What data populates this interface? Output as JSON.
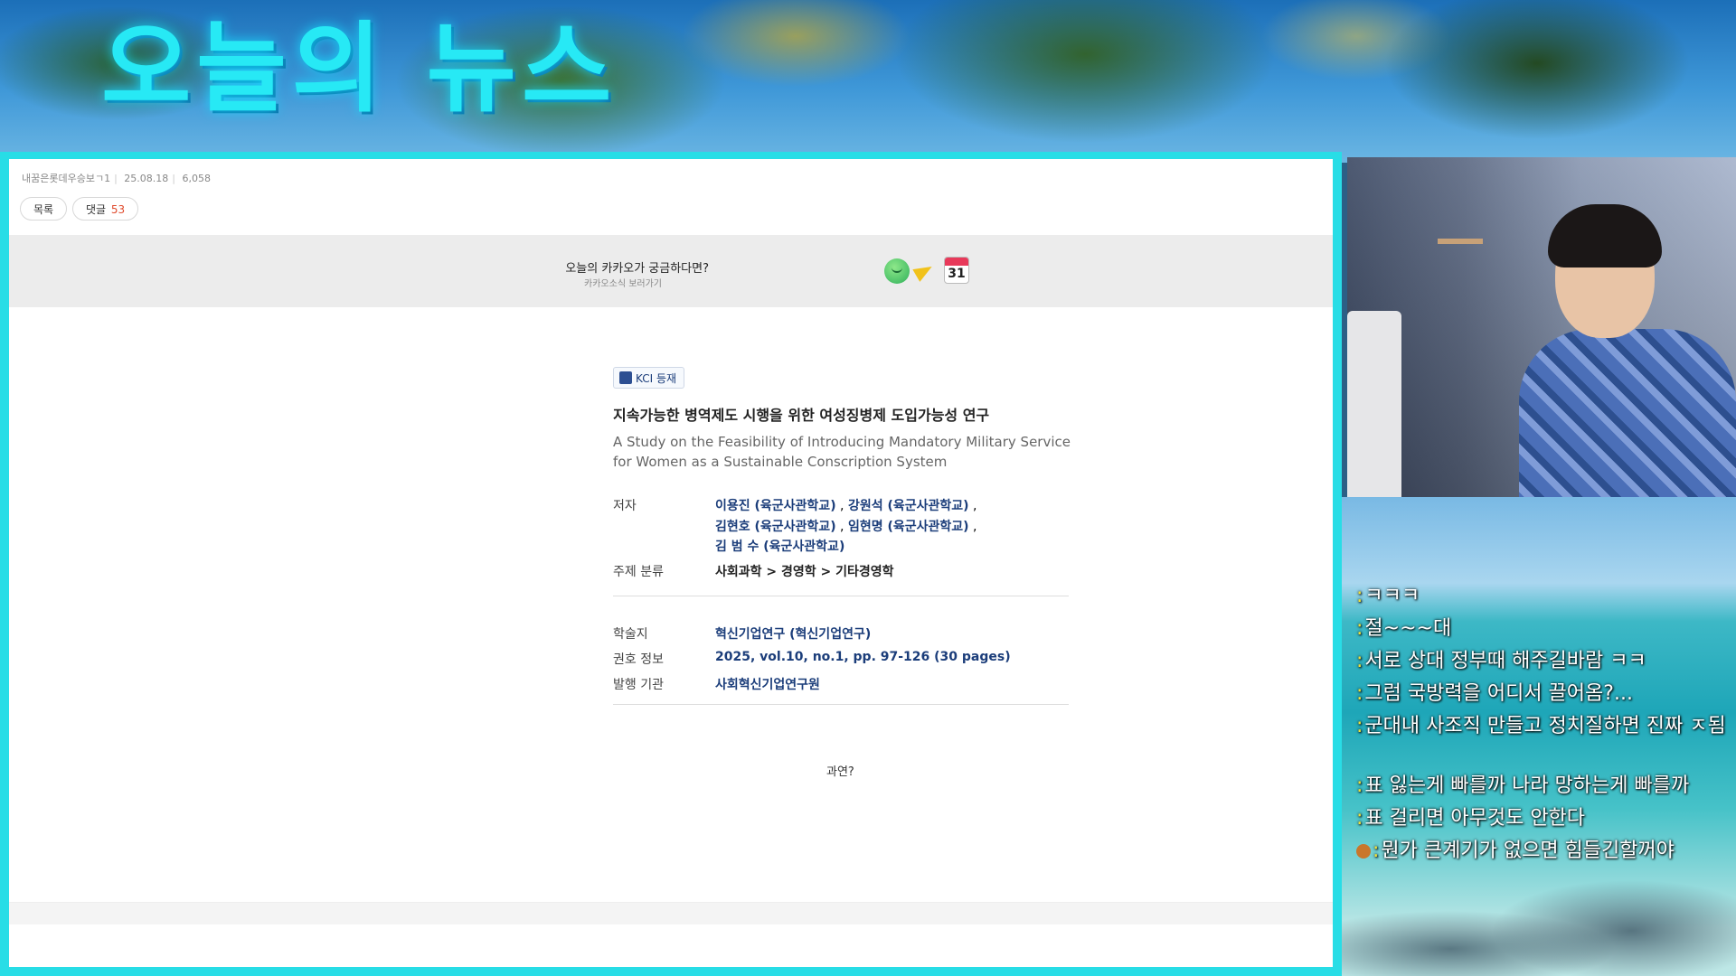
{
  "stream": {
    "title": "오늘의 뉴스",
    "title_color": "#27e9f5",
    "frame_color": "#28dde6"
  },
  "post": {
    "author": "내꿈은롯데우승보ㄱ1",
    "date": "25.08.18",
    "views": "6,058",
    "list_button": "목록",
    "comments_label": "댓글",
    "comments_count": "53"
  },
  "banner": {
    "title": "오늘의 카카오가 궁금하다면?",
    "subtitle": "카카오소식 보러가기",
    "icons": [
      "kakao-face-icon",
      "megaphone-icon",
      "calendar-icon"
    ],
    "calendar_day": "31"
  },
  "article": {
    "badge": "KCI 등재",
    "title_ko": "지속가능한 병역제도 시행을 위한 여성징병제 도입가능성 연구",
    "title_en": "A Study on the Feasibility of Introducing Mandatory Military Service for Women as a Sustainable Conscription System",
    "authors_label": "저자",
    "authors": [
      "이용진 (육군사관학교)",
      "강원석 (육군사관학교)",
      "김현호 (육군사관학교)",
      "임현명 (육군사관학교)",
      "김 범 수 (육군사관학교)"
    ],
    "subject_label": "주제 분류",
    "subject": "사회과학 > 경영학 > 기타경영학",
    "journal_label": "학술지",
    "journal": "혁신기업연구 (혁신기업연구)",
    "volume_label": "권호 정보",
    "volume": "2025, vol.10, no.1, pp. 97-126 (30 pages)",
    "publisher_label": "발행 기관",
    "publisher": "사회혁신기업연구원",
    "note": "과연?"
  },
  "chat": [
    {
      "text": "ㅋㅋㅋ"
    },
    {
      "text": "절~~~대"
    },
    {
      "text": "서로 상대 정부때 해주길바람 ㅋㅋ"
    },
    {
      "text": "그럼 국방력을 어디서 끌어옴?..."
    },
    {
      "text": "군대내 사조직 만들고 정치질하면 진짜 ㅈ됨"
    },
    {
      "text": "표 잃는게 빠를까 나라 망하는게 빠를까"
    },
    {
      "text": "표 걸리면 아무것도 안한다"
    },
    {
      "text": "뭔가 큰계기가 없으면 힘들긴할꺼야"
    }
  ]
}
